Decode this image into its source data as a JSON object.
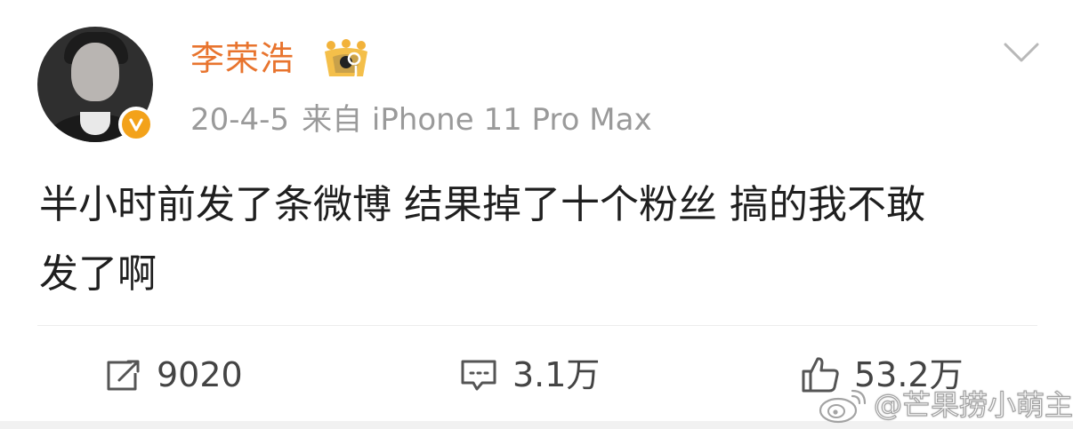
{
  "post": {
    "author": {
      "name": "李荣浩",
      "avatar_icon": "avatar-photo",
      "verified_icon": "verified-v-badge",
      "vip_icon": "vip-crown-badge"
    },
    "meta": {
      "date": "20-4-5",
      "source": "来自 iPhone 11 Pro Max"
    },
    "content": {
      "line1": "半小时前发了条微博 结果掉了十个粉丝 搞的我不敢",
      "line2": "发了啊"
    },
    "actions": {
      "repost_count": "9020",
      "comment_count": "3.1万",
      "like_count": "53.2万"
    }
  },
  "watermark": {
    "text": "@芒果捞小萌主"
  },
  "colors": {
    "username": "#e8742e",
    "verified_badge": "#f3a21a",
    "meta_text": "#9a9a9a",
    "body_text": "#1f1f1f",
    "action_text": "#444444"
  }
}
